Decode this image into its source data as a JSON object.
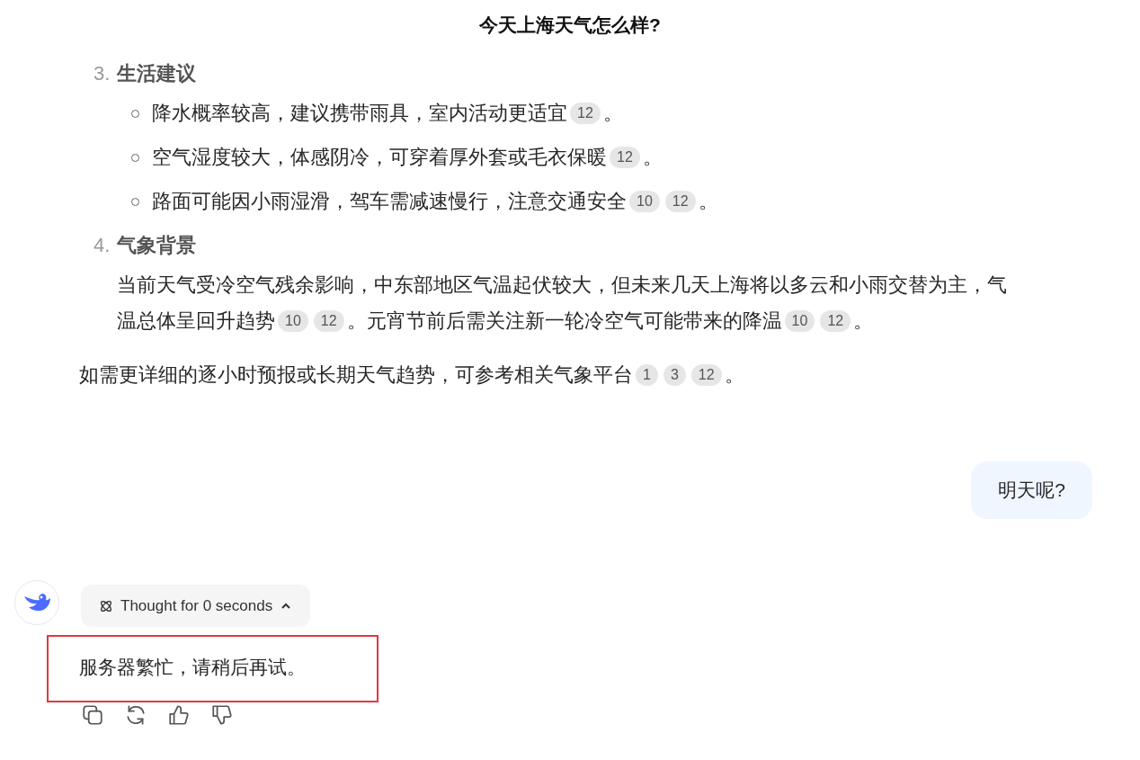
{
  "title": "今天上海天气怎么样?",
  "sections": [
    {
      "number": "3.",
      "heading": "生活建议",
      "bullets": [
        [
          {
            "text": "降水概率较高，建议携带雨具，室内活动更适宜",
            "citations": [
              "12"
            ]
          },
          {
            "text": "。"
          }
        ],
        [
          {
            "text": "空气湿度较大，体感阴冷，可穿着厚外套或毛衣保暖",
            "citations": [
              "12"
            ]
          },
          {
            "text": "。"
          }
        ],
        [
          {
            "text": "路面可能因小雨湿滑，驾车需减速慢行，注意交通安全",
            "citations": [
              "10",
              "12"
            ]
          },
          {
            "text": "。"
          }
        ]
      ]
    },
    {
      "number": "4.",
      "heading": "气象背景",
      "paragraph": [
        [
          {
            "text": "当前天气受冷空气残余影响，中东部地区气温起伏较大，但未来几天上海将以多云和小雨交替为主，气"
          }
        ],
        [
          {
            "text": "温总体呈回升趋势",
            "citations": [
              "10",
              "12"
            ]
          },
          {
            "text": "。元宵节前后需关注新一轮冷空气可能带来的降温",
            "citations": [
              "10",
              "12"
            ]
          },
          {
            "text": "。"
          }
        ]
      ]
    }
  ],
  "closing": [
    {
      "text": "如需更详细的逐小时预报或长期天气趋势，可参考相关气象平台",
      "citations": [
        "1",
        "3",
        "12"
      ]
    },
    {
      "text": "。"
    }
  ],
  "user_message": "明天呢?",
  "thought": {
    "label": "Thought for 0 seconds",
    "expanded": true
  },
  "reply": {
    "text": "服务器繁忙，请稍后再试。",
    "highlighted": true
  }
}
